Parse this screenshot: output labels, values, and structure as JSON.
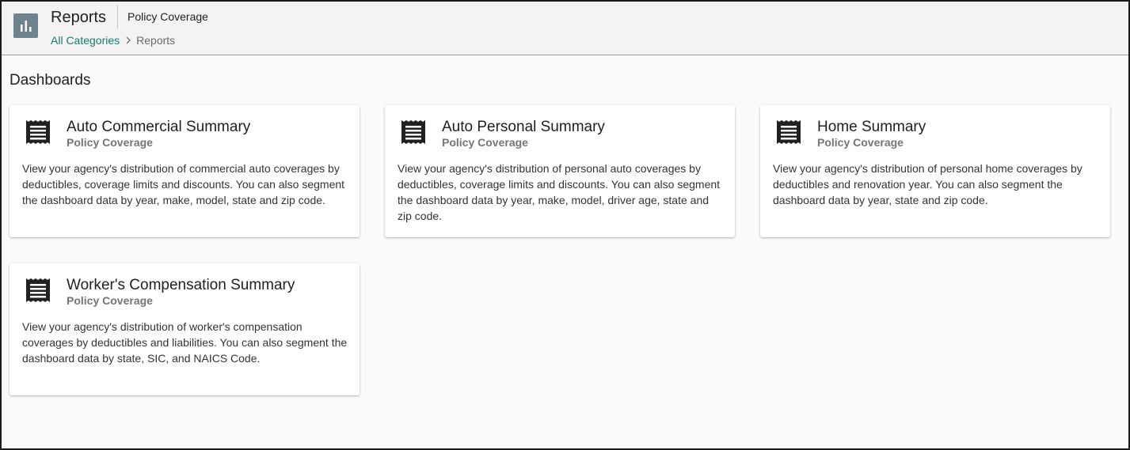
{
  "header": {
    "title": "Reports",
    "subtitle": "Policy Coverage",
    "app_icon": "bar-chart-icon",
    "breadcrumb": {
      "link": "All Categories",
      "separator_icon": "chevron-right-icon",
      "current": "Reports"
    }
  },
  "section": {
    "title": "Dashboards"
  },
  "cards": [
    {
      "title": "Auto Commercial Summary",
      "subtitle": "Policy Coverage",
      "icon": "receipt-icon",
      "description": "View your agency's distribution of commercial auto coverages by deductibles, coverage limits and discounts. You can also segment the dashboard data by year, make, model, state and zip code."
    },
    {
      "title": "Auto Personal Summary",
      "subtitle": "Policy Coverage",
      "icon": "receipt-icon",
      "description": "View your agency's distribution of personal auto coverages by deductibles, coverage limits and discounts. You can also segment the dashboard data by year, make, model, driver age, state and zip code."
    },
    {
      "title": "Home Summary",
      "subtitle": "Policy Coverage",
      "icon": "receipt-icon",
      "description": "View your agency's distribution of personal home coverages by deductibles and renovation year. You can also segment the dashboard data by year, state and zip code."
    },
    {
      "title": "Worker's Compensation Summary",
      "subtitle": "Policy Coverage",
      "icon": "receipt-icon",
      "description": "View your agency's distribution of worker's compensation coverages by deductibles and liabilities. You can also segment the dashboard data by state, SIC, and NAICS Code."
    }
  ],
  "colors": {
    "accent_link": "#1b7a6e",
    "app_icon_bg": "#6f838f",
    "background": "#fafafa",
    "header_bg": "#f3f3f3"
  }
}
